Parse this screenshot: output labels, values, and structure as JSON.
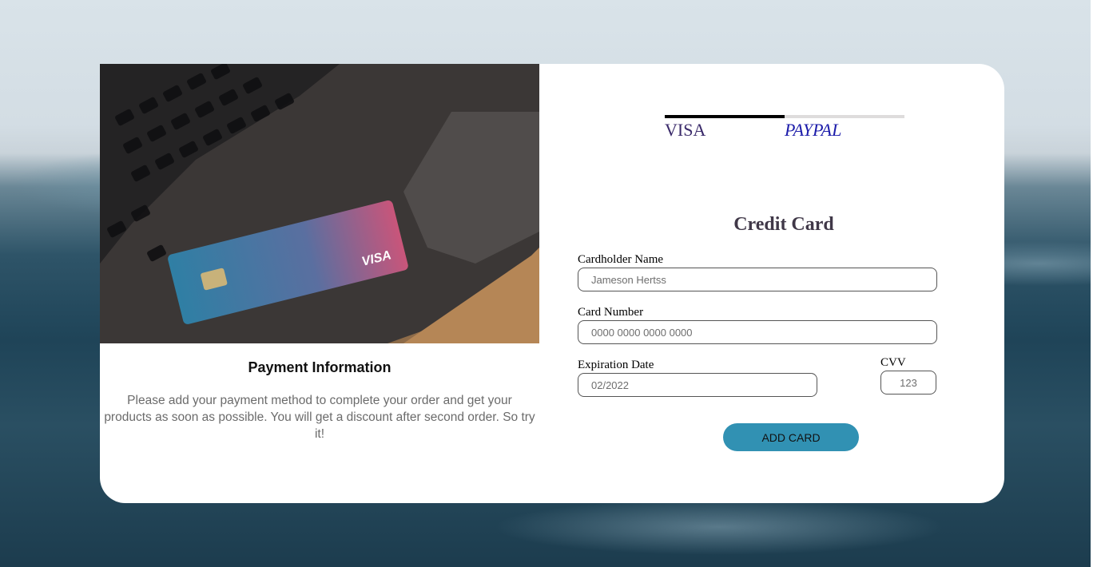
{
  "left_panel": {
    "title": "Payment Information",
    "description": "Please add your payment method to complete your order and get your products as soon as possible. You will get a discount after second order. So try it!",
    "photo_card_brand": "VISA"
  },
  "tabs": [
    {
      "label": "VISA",
      "active": true
    },
    {
      "label": "PAYPAL",
      "active": false
    }
  ],
  "form": {
    "title": "Credit Card",
    "cardholder": {
      "label": "Cardholder Name",
      "value": "Jameson Hertss"
    },
    "card_number": {
      "label": "Card Number",
      "value": "0000 0000 0000 0000"
    },
    "expiration": {
      "label": "Expiration Date",
      "value": "02/2022"
    },
    "cvv": {
      "label": "CVV",
      "value": "123"
    },
    "submit_label": "ADD CARD"
  },
  "colors": {
    "button": "#3191b3",
    "visa_tab": "#3a2a6a",
    "paypal_tab": "#1c1caa"
  }
}
